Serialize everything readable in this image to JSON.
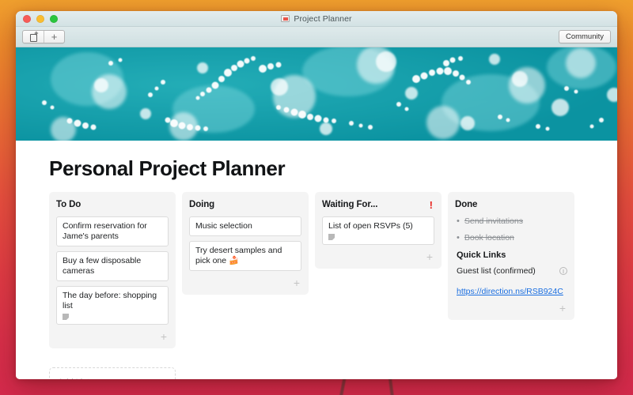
{
  "desktop": {
    "background_top_color": "#f0a02e",
    "background_bottom_color": "#d42a4c"
  },
  "window": {
    "titlebar": {
      "title": "Project Planner",
      "app_icon": "note-app-icon",
      "traffic_lights": [
        "close",
        "minimize",
        "zoom"
      ]
    },
    "toolbar": {
      "new_note_label": "",
      "add_label": "+",
      "community_label": "Community"
    },
    "hero": {
      "alt": "teal water with white bubbles banner",
      "base_color": "#15a0ad"
    }
  },
  "page": {
    "title": "Personal Project Planner"
  },
  "board": {
    "add_card_symbol": "+",
    "columns": [
      {
        "title": "To Do",
        "alert": "",
        "cards": [
          {
            "text": "Confirm reservation for Jame's parents",
            "note": false
          },
          {
            "text": "Buy a few disposable cameras",
            "note": false
          },
          {
            "text": "The day before: shopping list",
            "note": true
          }
        ]
      },
      {
        "title": "Doing",
        "alert": "",
        "cards": [
          {
            "text": "Music selection",
            "note": false
          },
          {
            "text": "Try desert samples and pick one 🍰",
            "note": false
          }
        ]
      },
      {
        "title": "Waiting For...",
        "alert": "!",
        "cards": [
          {
            "text": "List of open RSVPs (5)",
            "note": true
          }
        ]
      }
    ],
    "done_column": {
      "title": "Done",
      "items": [
        {
          "text": "Send invitations"
        },
        {
          "text": "Book location"
        }
      ],
      "quick_links_heading": "Quick Links",
      "quick_link_row": "Guest list (confirmed)",
      "quick_link_url": "https://direction.ns/RSB924C",
      "link_color": "#1a6ee0"
    },
    "add_list_label": "Add List"
  }
}
